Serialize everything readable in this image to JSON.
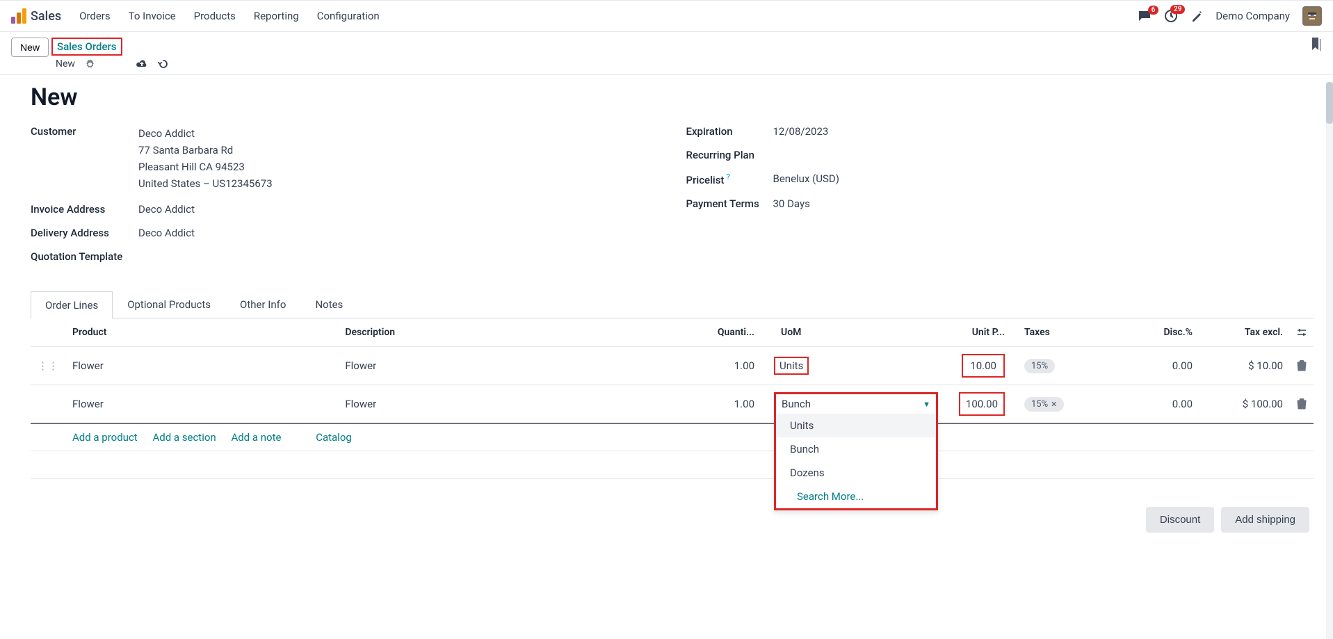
{
  "topbar": {
    "app": "Sales",
    "nav": [
      "Orders",
      "To Invoice",
      "Products",
      "Reporting",
      "Configuration"
    ],
    "msg_badge": "6",
    "activity_badge": "29",
    "company": "Demo Company"
  },
  "subbar": {
    "new_btn": "New",
    "breadcrumb": "Sales Orders",
    "crumb_current": "New"
  },
  "page": {
    "title": "New"
  },
  "left_fields": {
    "customer_label": "Customer",
    "customer_name": "Deco Addict",
    "customer_addr1": "77 Santa Barbara Rd",
    "customer_addr2": "Pleasant Hill CA 94523",
    "customer_addr3": "United States – US12345673",
    "invoice_label": "Invoice Address",
    "invoice_value": "Deco Addict",
    "delivery_label": "Delivery Address",
    "delivery_value": "Deco Addict",
    "template_label": "Quotation Template"
  },
  "right_fields": {
    "expiration_label": "Expiration",
    "expiration_value": "12/08/2023",
    "recurring_label": "Recurring Plan",
    "pricelist_label": "Pricelist",
    "pricelist_value": "Benelux (USD)",
    "terms_label": "Payment Terms",
    "terms_value": "30 Days"
  },
  "tabs": [
    "Order Lines",
    "Optional Products",
    "Other Info",
    "Notes"
  ],
  "table": {
    "headers": {
      "product": "Product",
      "description": "Description",
      "qty": "Quanti...",
      "uom": "UoM",
      "unit_price": "Unit P...",
      "taxes": "Taxes",
      "disc": "Disc.%",
      "tax_excl": "Tax excl."
    },
    "rows": [
      {
        "product": "Flower",
        "description": "Flower",
        "qty": "1.00",
        "uom": "Units",
        "unit_price": "10.00",
        "tax": "15%",
        "disc": "0.00",
        "excl": "$ 10.00",
        "editing": false
      },
      {
        "product": "Flower",
        "description": "Flower",
        "qty": "1.00",
        "uom": "Bunch",
        "unit_price": "100.00",
        "tax": "15%",
        "disc": "0.00",
        "excl": "$ 100.00",
        "editing": true
      }
    ],
    "dropdown": {
      "opt1": "Units",
      "opt2": "Bunch",
      "opt3": "Dozens",
      "search": "Search More..."
    },
    "actions": {
      "add_product": "Add a product",
      "add_section": "Add a section",
      "add_note": "Add a note",
      "catalog": "Catalog"
    }
  },
  "footer": {
    "discount": "Discount",
    "shipping": "Add shipping"
  }
}
